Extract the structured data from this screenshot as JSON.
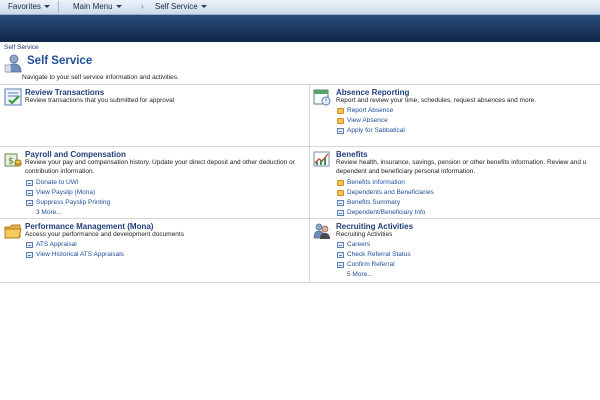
{
  "topnav": {
    "favorites": "Favorites",
    "main_menu": "Main Menu",
    "chevron": "›",
    "self_service": "Self Service"
  },
  "breadcrumb": "Self Service",
  "page": {
    "title": "Self Service",
    "description": "Navigate to your self service information and activities."
  },
  "tiles": {
    "review": {
      "title": "Review Transactions",
      "description": "Review transactions that you submitted for approval"
    },
    "absence": {
      "title": "Absence Reporting",
      "description": "Report and review your time, schedules, request absences and more.",
      "links": [
        "Report Absence",
        "View Absence",
        "Apply for Sabbatical"
      ]
    },
    "payroll": {
      "title": "Payroll and Compensation",
      "description": "Review your pay and compensation history. Update your direct deposit and other deduction or contribution information.",
      "links": [
        "Donate to UWI",
        "View Payslip (Mona)",
        "Suppress Payslip Printing"
      ],
      "more": "3 More..."
    },
    "benefits": {
      "title": "Benefits",
      "description": "Review health, insurance, savings, pension or other benefits information. Review and u dependent and beneficiary personal information.",
      "links": [
        "Benefits Information",
        "Dependents and Beneficiaries",
        "Benefits Summary",
        "Dependent/Beneficiary Info"
      ]
    },
    "performance": {
      "title": "Performance Management (Mona)",
      "description": "Access your performance and development documents",
      "links": [
        "ATS Appraisal",
        "View Historical ATS Appraisals"
      ]
    },
    "recruiting": {
      "title": "Recruiting Activities",
      "description": "Recruiting Activities",
      "links": [
        "Careers",
        "Check Referral Status",
        "Confirm Referral"
      ],
      "more": "5 More..."
    }
  }
}
